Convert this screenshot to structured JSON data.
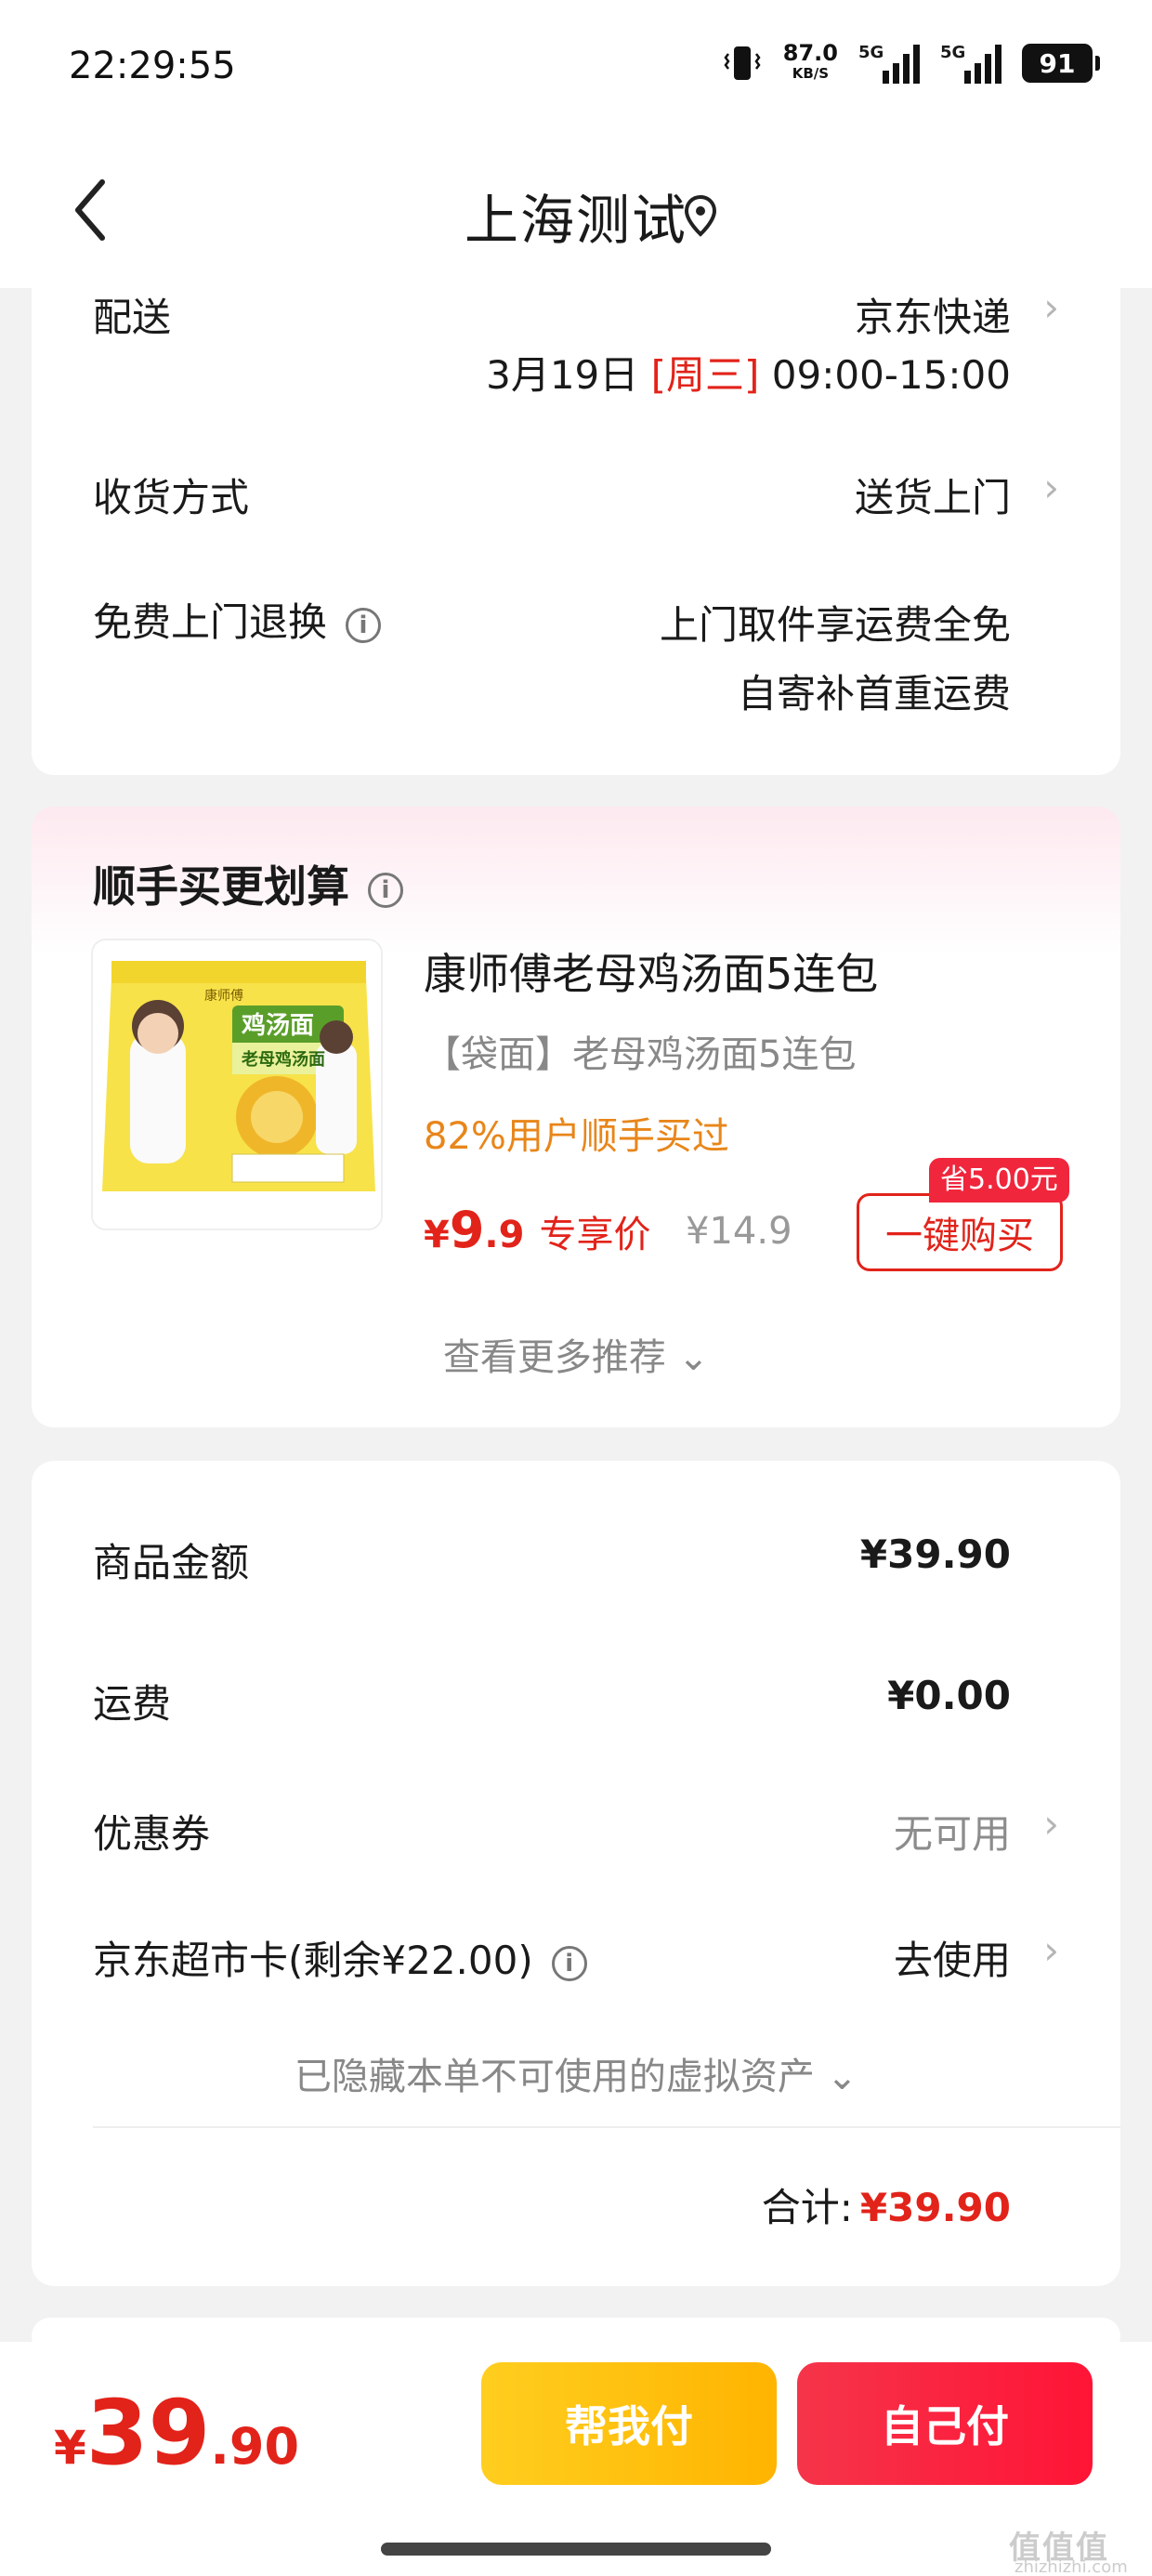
{
  "status_bar": {
    "time": "22:29:55",
    "net_speed": "87.0",
    "net_unit": "KB/S",
    "signal1": "5G",
    "signal2": "5G",
    "battery": "91"
  },
  "nav": {
    "title": "上海测试"
  },
  "delivery": {
    "label": "配送",
    "carrier": "京东快递",
    "date": "3月19日",
    "weekday": "[周三]",
    "time_range": "09:00-15:00",
    "receive_label": "收货方式",
    "receive_value": "送货上门",
    "return_label": "免费上门退换",
    "return_line1": "上门取件享运费全免",
    "return_line2": "自寄补首重运费"
  },
  "recommend": {
    "title": "顺手买更划算",
    "product_name": "康师傅老母鸡汤面5连包",
    "product_spec": "【袋面】老母鸡汤面5连包",
    "product_stat": "82%用户顺手买过",
    "price_currency": "¥",
    "price_int": "9",
    "price_dec": ".9",
    "price_tag": "专享价",
    "orig_price": "¥14.9",
    "save_badge": "省5.00元",
    "buy_button": "一键购买",
    "more_label": "查看更多推荐 ⌄",
    "package_brand": "康师傅",
    "package_name": "鸡汤面",
    "package_flavor": "老母鸡汤面"
  },
  "summary": {
    "goods_label": "商品金额",
    "goods_value": "¥39.90",
    "shipping_label": "运费",
    "shipping_value": "¥0.00",
    "coupon_label": "优惠券",
    "coupon_value": "无可用",
    "card_label": "京东超市卡(剩余¥22.00)",
    "card_value": "去使用",
    "hidden_label": "已隐藏本单不可使用的虚拟资产 ⌄",
    "total_label": "合计:",
    "total_value": "¥39.90"
  },
  "bottom": {
    "currency": "¥",
    "amount_int": "39",
    "amount_dec": ".90",
    "help_pay": "帮我付",
    "self_pay": "自己付"
  },
  "watermark": {
    "text": "值值值",
    "sub": "zhizhizhi.com"
  },
  "colors": {
    "accent_red": "#e2231a",
    "badge_red": "#f0263c",
    "stat_orange": "#e8861a",
    "help_yellow": "#ffc107"
  }
}
